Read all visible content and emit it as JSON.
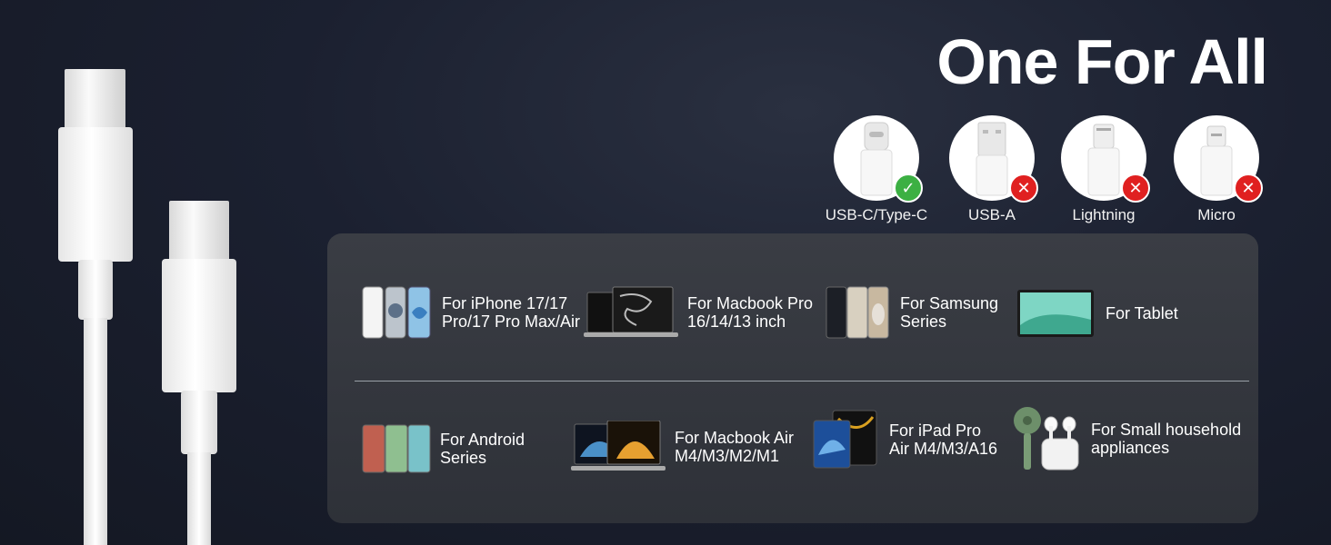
{
  "title": "One For All",
  "connectors": [
    {
      "label": "USB-C/Type-C",
      "status": "supported",
      "icon": "usb-c-icon"
    },
    {
      "label": "USB-A",
      "status": "unsupported",
      "icon": "usb-a-icon"
    },
    {
      "label": "Lightning",
      "status": "unsupported",
      "icon": "lightning-icon"
    },
    {
      "label": "Micro",
      "status": "unsupported",
      "icon": "micro-usb-icon"
    }
  ],
  "devices_row1": [
    {
      "line1": "For iPhone 17/17",
      "line2": "Pro/17 Pro Max/Air",
      "icon": "iphone-icon"
    },
    {
      "line1": "For Macbook Pro",
      "line2": "16/14/13 inch",
      "icon": "macbook-pro-icon"
    },
    {
      "line1": "For Samsung",
      "line2": "Series",
      "icon": "samsung-phone-icon"
    },
    {
      "line1": "For Tablet",
      "line2": "",
      "icon": "tablet-icon"
    }
  ],
  "devices_row2": [
    {
      "line1": "For Android",
      "line2": "Series",
      "icon": "android-phone-icon"
    },
    {
      "line1": "For Macbook Air",
      "line2": "M4/M3/M2/M1",
      "icon": "macbook-air-icon"
    },
    {
      "line1": "For iPad Pro",
      "line2": "Air M4/M3/A16",
      "icon": "ipad-icon"
    },
    {
      "line1": "For Small household",
      "line2": "appliances",
      "icon": "fan-earbuds-icon"
    }
  ],
  "colors": {
    "supported": "#3cb043",
    "unsupported": "#e02020",
    "panel": "#33363d",
    "background": "#1b2030"
  }
}
